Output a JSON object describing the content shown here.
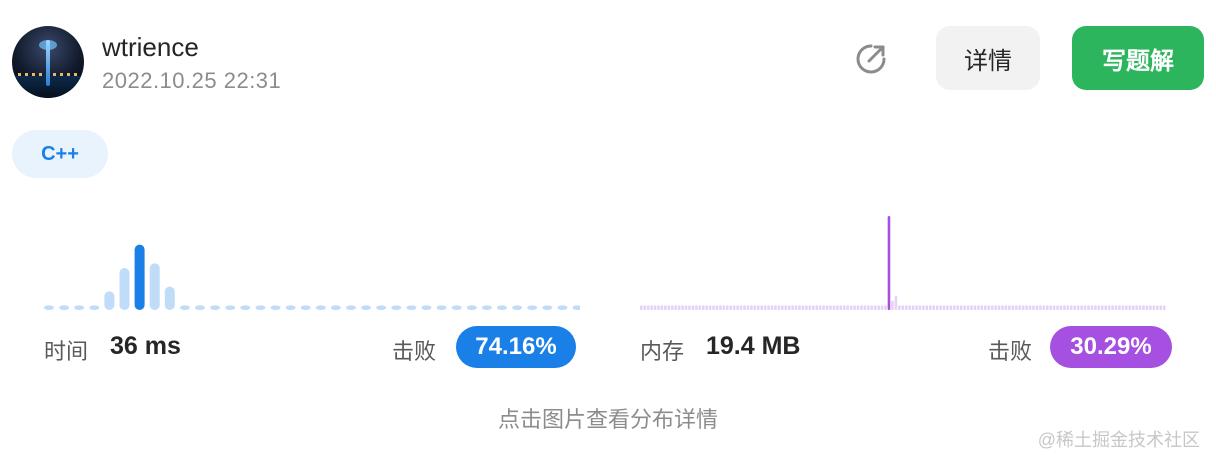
{
  "header": {
    "username": "wtrience",
    "timestamp": "2022.10.25 22:31",
    "detail_button": "详情",
    "write_solution_button": "写题解"
  },
  "language_tag": "C++",
  "stats": {
    "runtime": {
      "label": "时间",
      "value": "36 ms",
      "beat_label": "击败",
      "beat_percent": "74.16%",
      "color": "#1a7fe6",
      "light_color": "#bfdcf8"
    },
    "memory": {
      "label": "内存",
      "value": "19.4 MB",
      "beat_label": "击败",
      "beat_percent": "30.29%",
      "color": "#a550e0",
      "light_color": "#e6d2f7"
    }
  },
  "chart_data": [
    {
      "type": "bar",
      "series": [
        {
          "name": "时间",
          "values": [
            1,
            1,
            1,
            1,
            4,
            9,
            14,
            10,
            5,
            1,
            1,
            1,
            1,
            1,
            1,
            1,
            1,
            1,
            1,
            1,
            1,
            1,
            1,
            1,
            1,
            1,
            1,
            1,
            1,
            1,
            1,
            1,
            1,
            1,
            1,
            1
          ]
        }
      ],
      "highlight_index": 6,
      "ylim": [
        0,
        15
      ]
    },
    {
      "type": "bar",
      "series": [
        {
          "name": "内存",
          "values": [
            1,
            1,
            1,
            1,
            1,
            1,
            1,
            1,
            1,
            1,
            1,
            1,
            1,
            1,
            1,
            1,
            1,
            1,
            1,
            1,
            1,
            1,
            1,
            1,
            1,
            1,
            1,
            1,
            1,
            1,
            1,
            1,
            1,
            1,
            1,
            1,
            1,
            1,
            1,
            1,
            1,
            1,
            1,
            1,
            1,
            1,
            1,
            1,
            1,
            1,
            1,
            1,
            1,
            1,
            1,
            1,
            1,
            1,
            1,
            1,
            1,
            1,
            1,
            1,
            1,
            1,
            1,
            1,
            1,
            1,
            1,
            1,
            20,
            2,
            3,
            1,
            1,
            1,
            1,
            1,
            1,
            1,
            1,
            1,
            1,
            1,
            1,
            1,
            1,
            1,
            1,
            1,
            1,
            1,
            1,
            1,
            1,
            1,
            1,
            1,
            1,
            1,
            1,
            1,
            1,
            1,
            1,
            1,
            1,
            1,
            1,
            1,
            1,
            1,
            1,
            1,
            1,
            1,
            1,
            1,
            1,
            1,
            1,
            1,
            1,
            1,
            1,
            1,
            1,
            1,
            1,
            1,
            1,
            1,
            1,
            1,
            1,
            1,
            1,
            1,
            1,
            1,
            1,
            1,
            1,
            1,
            1,
            1,
            1,
            1,
            1,
            1,
            1
          ]
        }
      ],
      "highlight_index": 72,
      "ylim": [
        0,
        20
      ]
    }
  ],
  "footer": {
    "hint": "点击图片查看分布详情",
    "watermark": "@稀土掘金技术社区"
  }
}
